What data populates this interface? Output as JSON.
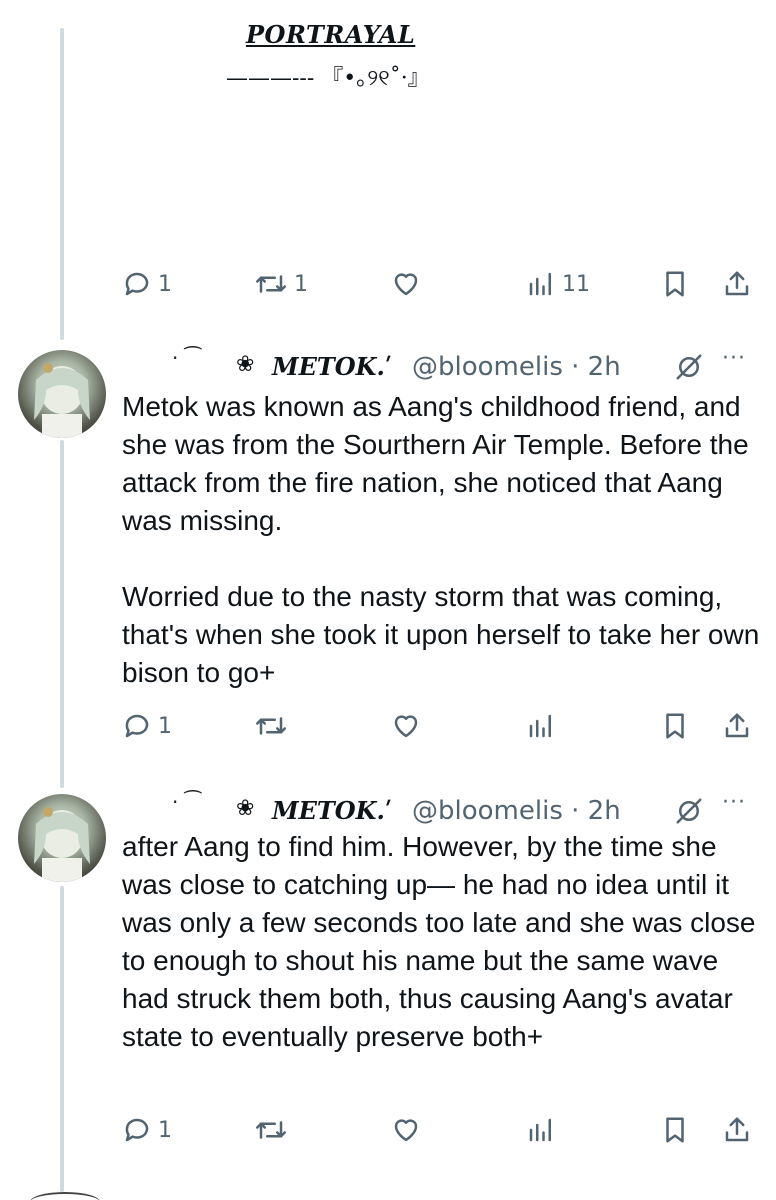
{
  "top_card": {
    "title": "PORTRAYAL",
    "subtitle": "———--- 『•｡୨୧˚·』",
    "actions": {
      "reply_count": "1",
      "repost_count": "1",
      "like_count": "",
      "views_count": "11"
    }
  },
  "tweets": [
    {
      "header_decoration": "· ⁀",
      "flower": "❀",
      "display_name": "METOK.ʹ",
      "handle_time": "@bloomelis · 2h",
      "more": "···",
      "text": "Metok was known as Aang's childhood friend, and she was from the Sourthern Air Temple. Before the attack from the fire nation, she noticed that Aang was missing.\n\nWorried due to the nasty storm that was coming, that's when she took it upon herself to take her own bison to go+",
      "actions": {
        "reply_count": "1",
        "repost_count": "",
        "like_count": "",
        "views_count": ""
      }
    },
    {
      "header_decoration": "· ⁀",
      "flower": "❀",
      "display_name": "METOK.ʹ",
      "handle_time": "@bloomelis · 2h",
      "more": "···",
      "text": "after Aang to find him. However, by the time she was close to catching up— he had no idea until it was only a few seconds too late and she was close to enough to shout his name but the same wave had struck them both, thus causing Aang's avatar state to eventually preserve both+",
      "actions": {
        "reply_count": "1",
        "repost_count": "",
        "like_count": "",
        "views_count": ""
      }
    }
  ],
  "icons": {
    "reply": "reply-icon",
    "repost": "repost-icon",
    "like": "heart-icon",
    "views": "views-icon",
    "bookmark": "bookmark-icon",
    "share": "share-icon",
    "grok": "grok-icon",
    "more": "more-icon"
  },
  "colors": {
    "text": "#0f1419",
    "secondary": "#536471",
    "thread_line": "#cfd9de",
    "background": "#ffffff"
  }
}
